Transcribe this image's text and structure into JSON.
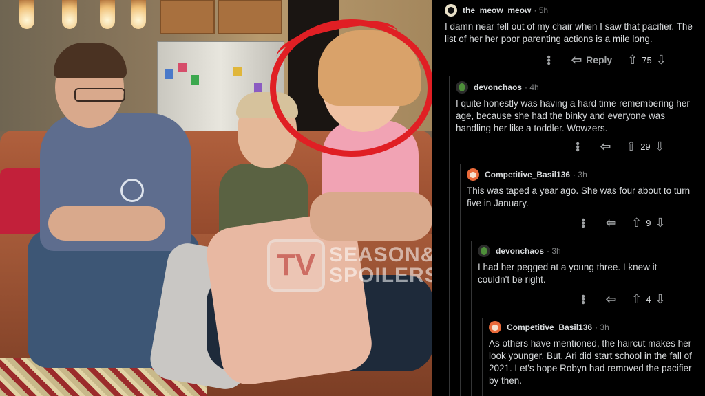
{
  "watermark": {
    "tv": "TV",
    "line1": "SEASON&",
    "line2": "SPOILERS"
  },
  "comments": [
    {
      "user": "the_meow_meow",
      "time": "5h",
      "avatar": "cat-avatar",
      "body": "I damn near fell out of my chair when I saw that pacifier. The list of her her poor parenting actions is a mile long.",
      "reply_label": "Reply",
      "votes": "75"
    },
    {
      "user": "devonchaos",
      "time": "4h",
      "avatar": "snoo-avatar",
      "body": "I quite honestly was having a hard time remembering her age, because she had the binky and everyone was handling her like a toddler. Wowzers.",
      "votes": "29"
    },
    {
      "user": "Competitive_Basil136",
      "time": "3h",
      "avatar": "snoo-avatar",
      "body": "This was taped a year ago. She was four about to turn five in January.",
      "votes": "9"
    },
    {
      "user": "devonchaos",
      "time": "3h",
      "avatar": "snoo-avatar",
      "body": "I had her pegged at a young three. I knew it couldn't be right.",
      "votes": "4"
    },
    {
      "user": "Competitive_Basil136",
      "time": "3h",
      "avatar": "snoo-avatar",
      "body": "As others have mentioned, the haircut makes her look younger. But, Ari did start school in the fall of 2021. Let's hope Robyn had removed the pacifier by then."
    }
  ],
  "icons": {
    "more": "more-options-icon",
    "reply": "reply-arrow-icon",
    "upvote": "upvote-arrow-icon",
    "downvote": "downvote-arrow-icon"
  },
  "colors": {
    "highlight_circle": "#e01f24",
    "thread_background": "#000000",
    "text": "#d7dadc",
    "muted": "#818384"
  }
}
